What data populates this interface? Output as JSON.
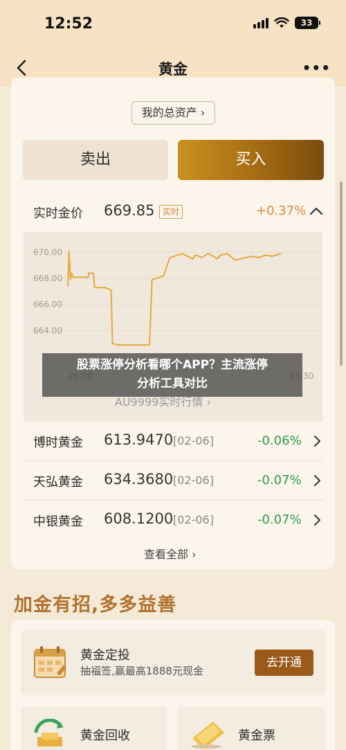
{
  "status_bar": {
    "time": "12:52",
    "battery": "33"
  },
  "nav": {
    "title": "黄金",
    "more": "•••"
  },
  "account": {
    "total_assets_label": "我的总资产 ›"
  },
  "trade": {
    "sell_label": "卖出",
    "buy_label": "买入"
  },
  "price": {
    "label": "实时金价",
    "value": "669.85",
    "badge": "实时",
    "change": "+0.37%"
  },
  "chart_data": {
    "type": "line",
    "ylim": [
      662.0,
      670.5
    ],
    "y_ticks": [
      "670.00",
      "668.00",
      "666.00",
      "664.00"
    ],
    "x_ticks": [
      "20:00",
      "15:30"
    ],
    "x": [
      0,
      2,
      4,
      6,
      8,
      12,
      18,
      32,
      33,
      40,
      42,
      52,
      58,
      68,
      70,
      80,
      128,
      132,
      150,
      160,
      180,
      196,
      200,
      210,
      220,
      228,
      234,
      240,
      250,
      262,
      280,
      290,
      300,
      310,
      320,
      334
    ],
    "values": [
      667.4,
      670.1,
      667.9,
      668.4,
      668.1,
      668.1,
      668.1,
      668.1,
      668.4,
      668.4,
      667.3,
      667.3,
      667.3,
      667.1,
      663.0,
      662.9,
      662.9,
      667.9,
      668.2,
      669.6,
      669.9,
      669.5,
      669.8,
      669.6,
      669.9,
      669.7,
      669.5,
      669.8,
      669.9,
      669.4,
      669.6,
      669.7,
      669.6,
      669.8,
      669.7,
      669.9
    ],
    "link_label": "AU9999实时行情 ›"
  },
  "banner": {
    "line1": "股票涨停分析看哪个APP？主流涨停",
    "line2": "分析工具对比"
  },
  "quotes": [
    {
      "name": "博时黄金",
      "value": "613.9470",
      "date": "[02-06]",
      "change": "-0.06%"
    },
    {
      "name": "天弘黄金",
      "value": "634.3680",
      "date": "[02-06]",
      "change": "-0.07%"
    },
    {
      "name": "中银黄金",
      "value": "608.1200",
      "date": "[02-06]",
      "change": "-0.07%"
    }
  ],
  "view_all_label": "查看全部 ›",
  "promo": {
    "title": "加金有招,多多益善",
    "dca": {
      "title": "黄金定投",
      "subtitle": "抽福签,赢最高1888元现金",
      "button": "去开通"
    },
    "recycle": {
      "title": "黄金回收"
    },
    "ticket": {
      "title": "黄金票"
    }
  },
  "colors": {
    "accent": "#e08a3c",
    "buy": "#a46b12",
    "down": "#2f9a4a",
    "chart_line": "#e6a93a"
  }
}
